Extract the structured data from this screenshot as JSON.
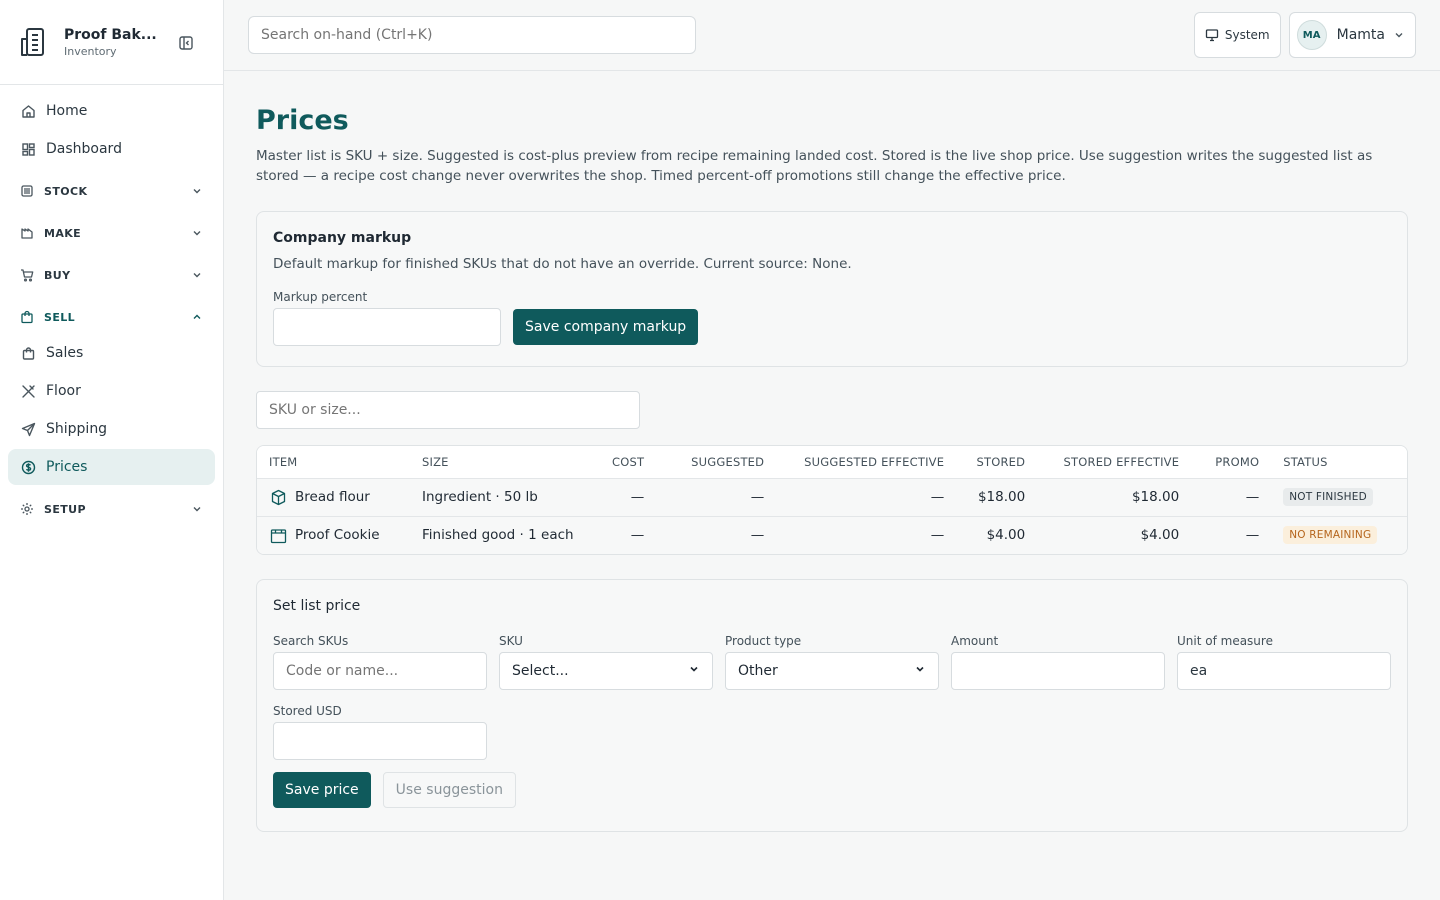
{
  "brand": {
    "name": "Proof Bak...",
    "subtitle": "Inventory"
  },
  "nav": {
    "home": "Home",
    "dashboard": "Dashboard",
    "stock": "STOCK",
    "make": "MAKE",
    "buy": "BUY",
    "sell": "SELL",
    "sales": "Sales",
    "floor": "Floor",
    "shipping": "Shipping",
    "prices": "Prices",
    "setup": "SETUP"
  },
  "topbar": {
    "search_placeholder": "Search on-hand (Ctrl+K)",
    "system_label": "System",
    "avatar_initials": "MA",
    "user_name": "Mamta"
  },
  "page": {
    "title": "Prices",
    "description": "Master list is SKU + size. Suggested is cost-plus preview from recipe remaining landed cost. Stored is the live shop price. Use suggestion writes the suggested list as stored — a recipe cost change never overwrites the shop. Timed percent-off promotions still change the effective price."
  },
  "markup": {
    "title": "Company markup",
    "description": "Default markup for finished SKUs that do not have an override. Current source: None.",
    "field_label": "Markup percent",
    "field_value": "",
    "save_label": "Save company markup"
  },
  "filter": {
    "placeholder": "SKU or size..."
  },
  "table": {
    "headers": [
      "ITEM",
      "SIZE",
      "COST",
      "SUGGESTED",
      "SUGGESTED EFFECTIVE",
      "STORED",
      "STORED EFFECTIVE",
      "PROMO",
      "STATUS"
    ],
    "rows": [
      {
        "item": "Bread flour",
        "icon": "box-icon",
        "size": "Ingredient · 50 lb",
        "cost": "—",
        "suggested": "—",
        "suggested_effective": "—",
        "stored": "$18.00",
        "stored_effective": "$18.00",
        "promo": "—",
        "status": "NOT FINISHED"
      },
      {
        "item": "Proof Cookie",
        "icon": "bag-icon",
        "size": "Finished good · 1 each",
        "cost": "—",
        "suggested": "—",
        "suggested_effective": "—",
        "stored": "$4.00",
        "stored_effective": "$4.00",
        "promo": "—",
        "status": "NO REMAINING"
      }
    ]
  },
  "set_price": {
    "title": "Set list price",
    "search_label": "Search SKUs",
    "search_placeholder": "Code or name...",
    "sku_label": "SKU",
    "sku_value": "Select...",
    "type_label": "Product type",
    "type_value": "Other",
    "amount_label": "Amount",
    "amount_value": "",
    "uom_label": "Unit of measure",
    "uom_value": "ea",
    "stored_label": "Stored USD",
    "stored_value": "",
    "save_label": "Save price",
    "suggest_label": "Use suggestion"
  },
  "colors": {
    "accent": "#0f5a5c",
    "active_bg": "#e6f0f0",
    "amber_badge": "#b5651d"
  }
}
